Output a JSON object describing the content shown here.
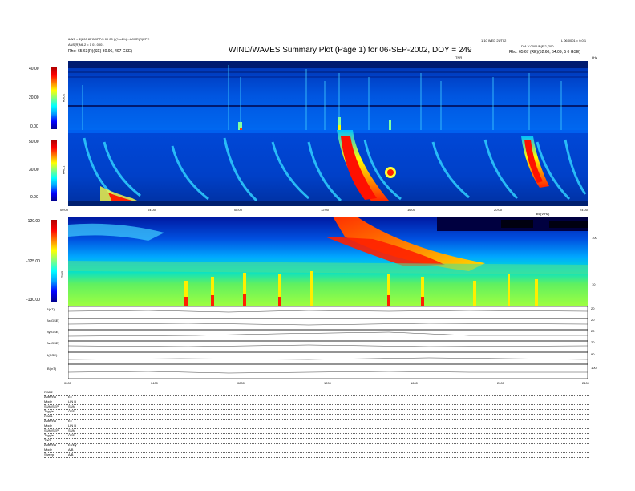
{
  "header": {
    "title": "WIND/WAVES Summary Plot (Page 1) for 06-SEP-2002, DOY = 249",
    "left_line1": "6/3/0 = 2(200 8PC/9PP/0 00 00 ) (%x4%) - A/IMR(R)EPE",
    "left_line2": "ANS(R)N6.2 = 1 01 0001",
    "left_rho": "Rho:  65.63(R)(SE) 30.96, 497 GSE)",
    "right_line1": "L 06 0001 = 0.0 1",
    "right_line2": "D.A.V 0001/R(F 2, 200",
    "right_rho": "Rho:  65.67 (RE)(52.60, 54.09, 5 0 GSE)",
    "center_right_small": "1.10 WED 2UT02",
    "right_top_label": "TNR",
    "right_top_unit": "kHz"
  },
  "panels": {
    "rad2": {
      "label": "RAD2",
      "ticks": [
        "40.00",
        "20.00",
        "0.00"
      ]
    },
    "rad1": {
      "label": "RAD1",
      "ticks": [
        "50.00",
        "30.00",
        "0.00"
      ]
    },
    "tnr": {
      "label": "TNR",
      "ticks": [
        "-120.00",
        "-125.00",
        "-130.00"
      ],
      "right_ticks": [
        "100",
        "10"
      ],
      "right_unit": "dB/(V/Hz)"
    }
  },
  "time_axis": {
    "labels": [
      "00:00",
      "04:00",
      "08:00",
      "12:00",
      "16:00",
      "20:00",
      "24:00"
    ],
    "bottom_labels": [
      "0000",
      "0400",
      "0800",
      "1200",
      "1600",
      "2000",
      "2400"
    ]
  },
  "mag_panels": [
    {
      "label": "B(nT)",
      "right": [
        "20",
        "10"
      ]
    },
    {
      "label": "Bx(GSE)",
      "right": [
        "20",
        "0"
      ]
    },
    {
      "label": "By(GSE)",
      "right": [
        "20",
        "0"
      ]
    },
    {
      "label": "Bz(GSE)",
      "right": [
        "20",
        "0"
      ]
    },
    {
      "label": "θ(GSE)",
      "right": [
        "90",
        "0"
      ]
    },
    {
      "label": "|B|(nT)",
      "right": [
        "100",
        "10"
      ]
    }
  ],
  "info": [
    {
      "label": "RAD2",
      "value": ""
    },
    {
      "label": "Antenna",
      "value": "Ex"
    },
    {
      "label": "Mode",
      "value": "LIN B"
    },
    {
      "label": "SUM/SEP",
      "value": "SUM"
    },
    {
      "label": "Toggle",
      "value": "OFF"
    },
    {
      "label": "RAD1",
      "value": ""
    },
    {
      "label": "Antenna",
      "value": "Ex"
    },
    {
      "label": "Mode",
      "value": "LIN B"
    },
    {
      "label": "SUM/SEP",
      "value": "SUM"
    },
    {
      "label": "Toggle",
      "value": "OFF"
    },
    {
      "label": "TNR",
      "value": ""
    },
    {
      "label": "Antenna",
      "value": "Ex/Ey"
    },
    {
      "label": "Mode",
      "value": "A/B"
    },
    {
      "label": "Sweep",
      "value": "A/B"
    }
  ],
  "colors": {
    "bg_spectrum": "#0030c0",
    "accent": "#ff0000"
  }
}
